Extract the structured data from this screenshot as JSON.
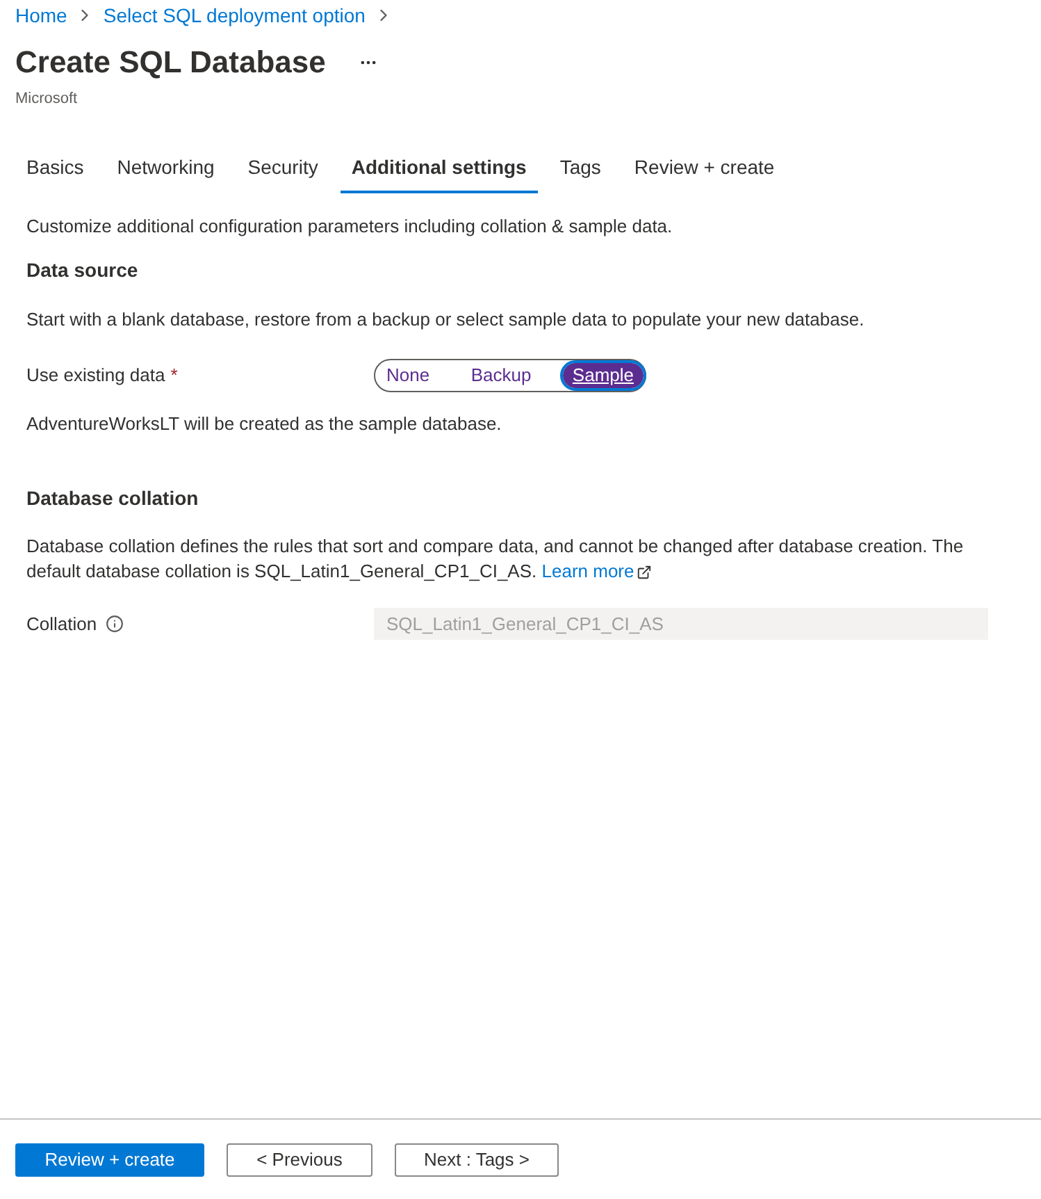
{
  "breadcrumb": [
    "Home",
    "Select SQL deployment option"
  ],
  "title": "Create SQL Database",
  "publisher": "Microsoft",
  "tabs": [
    {
      "label": "Basics",
      "selected": false
    },
    {
      "label": "Networking",
      "selected": false
    },
    {
      "label": "Security",
      "selected": false
    },
    {
      "label": "Additional settings",
      "selected": true
    },
    {
      "label": "Tags",
      "selected": false
    },
    {
      "label": "Review + create",
      "selected": false
    }
  ],
  "intro": "Customize additional configuration parameters including collation & sample data.",
  "data_source": {
    "heading": "Data source",
    "description": "Start with a blank database, restore from a backup or select sample data to populate your new database.",
    "field_label": "Use existing data",
    "required_mark": "*",
    "options": [
      {
        "label": "None",
        "selected": false
      },
      {
        "label": "Backup",
        "selected": false
      },
      {
        "label": "Sample",
        "selected": true
      }
    ],
    "note": "AdventureWorksLT will be created as the sample database."
  },
  "collation": {
    "heading": "Database collation",
    "description": "Database collation defines the rules that sort and compare data, and cannot be changed after database creation. The default database collation is SQL_Latin1_General_CP1_CI_AS.",
    "link": "Learn more",
    "field_label": "Collation",
    "value": "SQL_Latin1_General_CP1_CI_AS",
    "disabled": true
  },
  "footer_buttons": [
    {
      "label": "Review + create",
      "kind": "primary"
    },
    {
      "label": "< Previous",
      "kind": "secondary"
    },
    {
      "label": "Next : Tags >",
      "kind": "secondary"
    }
  ]
}
